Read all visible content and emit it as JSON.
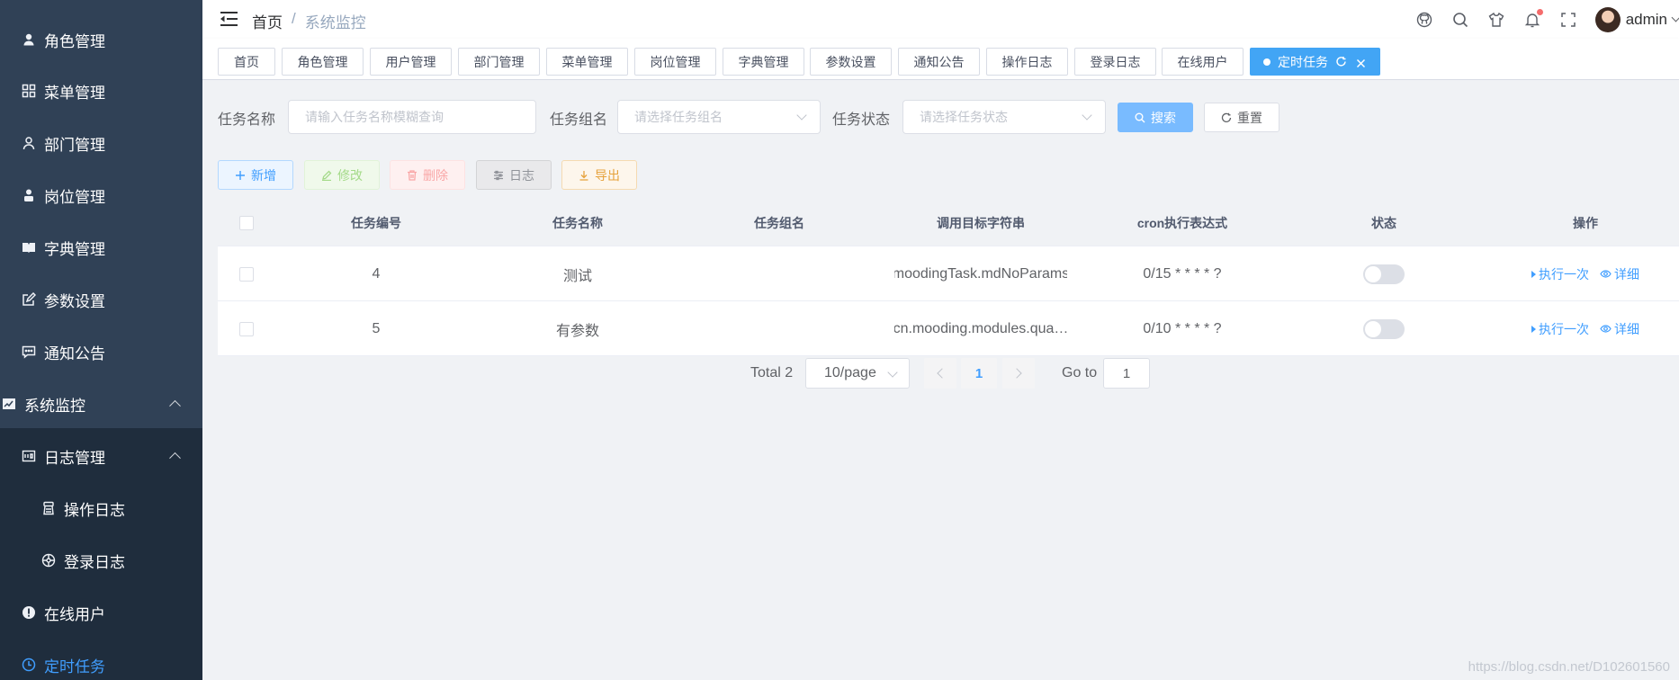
{
  "sidebar": {
    "items": [
      {
        "label": "角色管理",
        "icon": "user-icon"
      },
      {
        "label": "菜单管理",
        "icon": "grid-icon"
      },
      {
        "label": "部门管理",
        "icon": "person-outline-icon"
      },
      {
        "label": "岗位管理",
        "icon": "user-solid-icon"
      },
      {
        "label": "字典管理",
        "icon": "book-icon"
      },
      {
        "label": "参数设置",
        "icon": "edit-icon"
      },
      {
        "label": "通知公告",
        "icon": "message-icon"
      },
      {
        "label": "系统监控",
        "icon": "monitor-icon"
      },
      {
        "label": "日志管理",
        "icon": "log-icon"
      },
      {
        "label": "操作日志",
        "icon": "form-icon"
      },
      {
        "label": "登录日志",
        "icon": "logininfor-icon"
      },
      {
        "label": "在线用户",
        "icon": "online-icon"
      },
      {
        "label": "定时任务",
        "icon": "clock-icon"
      }
    ],
    "active_color": "#409eff",
    "bg_color": "#304156"
  },
  "navbar": {
    "breadcrumb": {
      "home": "首页",
      "separator": "/",
      "current": "系统监控"
    },
    "icons": [
      "github-icon",
      "search-icon",
      "theme-icon",
      "bell-icon",
      "fullscreen-icon"
    ],
    "username": "admin"
  },
  "tags": [
    {
      "label": "首页"
    },
    {
      "label": "角色管理"
    },
    {
      "label": "用户管理"
    },
    {
      "label": "部门管理"
    },
    {
      "label": "菜单管理"
    },
    {
      "label": "岗位管理"
    },
    {
      "label": "字典管理"
    },
    {
      "label": "参数设置"
    },
    {
      "label": "通知公告"
    },
    {
      "label": "操作日志"
    },
    {
      "label": "登录日志"
    },
    {
      "label": "在线用户"
    },
    {
      "label": "定时任务",
      "active": true
    }
  ],
  "search": {
    "job_name_label": "任务名称",
    "job_name_placeholder": "请输入任务名称模糊查询",
    "job_group_label": "任务组名",
    "job_group_placeholder": "请选择任务组名",
    "status_label": "任务状态",
    "status_placeholder": "请选择任务状态",
    "search_button": "搜索",
    "reset_button": "重置"
  },
  "toolbar": {
    "add": "新增",
    "edit": "修改",
    "delete": "删除",
    "log": "日志",
    "export": "导出"
  },
  "table": {
    "headers": [
      "任务编号",
      "任务名称",
      "任务组名",
      "调用目标字符串",
      "cron执行表达式",
      "状态",
      "操作"
    ],
    "rows": [
      {
        "id": "4",
        "name": "测试",
        "group": "",
        "target": "moodingTask.mdNoParams",
        "cron": "0/15 * * * * ?",
        "status_on": false
      },
      {
        "id": "5",
        "name": "有参数",
        "group": "",
        "target": "cn.mooding.modules.qua…",
        "cron": "0/10 * * * * ?",
        "status_on": false
      }
    ],
    "op_run": "执行一次",
    "op_detail": "详细"
  },
  "pagination": {
    "total": "Total 2",
    "page_size": "10/page",
    "current_page": "1",
    "goto_label": "Go to",
    "goto_value": "1"
  },
  "watermark": "https://blog.csdn.net/D102601560"
}
